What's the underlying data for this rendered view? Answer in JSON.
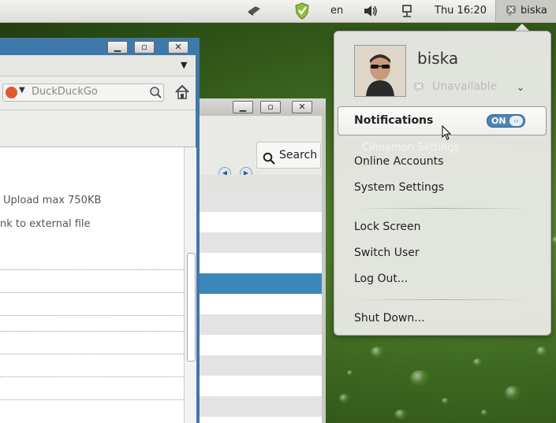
{
  "panel": {
    "language": "en",
    "clock": "Thu 16:20",
    "username": "biska",
    "icons": [
      "screenshot-icon",
      "shield-check-icon",
      "volume-icon",
      "network-icon",
      "user-status-icon"
    ]
  },
  "browser": {
    "search_engine_placeholder": "DuckDuckGo",
    "upload_note": "Upload max 750KB",
    "link_note": "nk to external file",
    "icons": [
      "duckduckgo-icon",
      "dropdown-arrow-icon",
      "magnifier-icon",
      "home-icon"
    ]
  },
  "file_window": {
    "search_label": "Search",
    "icons": [
      "back-arrow-icon",
      "forward-arrow-icon",
      "search-icon"
    ]
  },
  "user_menu": {
    "name": "biska",
    "status": "Unavailable",
    "notifications_label": "Notifications",
    "toggle_label": "ON",
    "ghost_tooltip": "Cinnamon Settings",
    "items": [
      {
        "label": "Online Accounts"
      },
      {
        "label": "System Settings"
      },
      {
        "label": "Lock Screen"
      },
      {
        "label": "Switch User"
      },
      {
        "label": "Log Out..."
      },
      {
        "label": "Shut Down..."
      }
    ]
  },
  "colors": {
    "accent": "#3c87ba",
    "toggle_blue": "#4a86b4",
    "desktop_green": "#3f6a22"
  }
}
